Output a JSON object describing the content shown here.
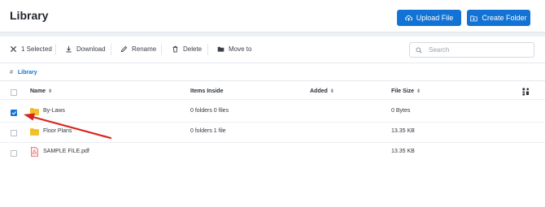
{
  "header": {
    "title": "Library",
    "upload_label": "Upload File",
    "create_folder_label": "Create Folder"
  },
  "toolbar": {
    "selected_label": "1 Selected",
    "download_label": "Download",
    "rename_label": "Rename",
    "delete_label": "Delete",
    "move_label": "Move to",
    "search_placeholder": "Search"
  },
  "breadcrumb": {
    "hash": "#",
    "current": "Library"
  },
  "table": {
    "columns": [
      "Name",
      "Items Inside",
      "Added",
      "File Size"
    ],
    "rows": [
      {
        "name": "By-Laws",
        "items": "0 folders 0 files",
        "added": "",
        "size": "0 Bytes",
        "type": "folder",
        "checked": true
      },
      {
        "name": "Floor Plans",
        "items": "0 folders 1 file",
        "added": "",
        "size": "13.35 KB",
        "type": "folder",
        "checked": false
      },
      {
        "name": "SAMPLE FILE.pdf",
        "items": "",
        "added": "",
        "size": "13.35 KB",
        "type": "pdf",
        "checked": false
      }
    ]
  },
  "colors": {
    "primary": "#1273d4",
    "folder": "#f2c12e",
    "pdf": "#e35d5d",
    "annotation_arrow": "#d9241c"
  }
}
